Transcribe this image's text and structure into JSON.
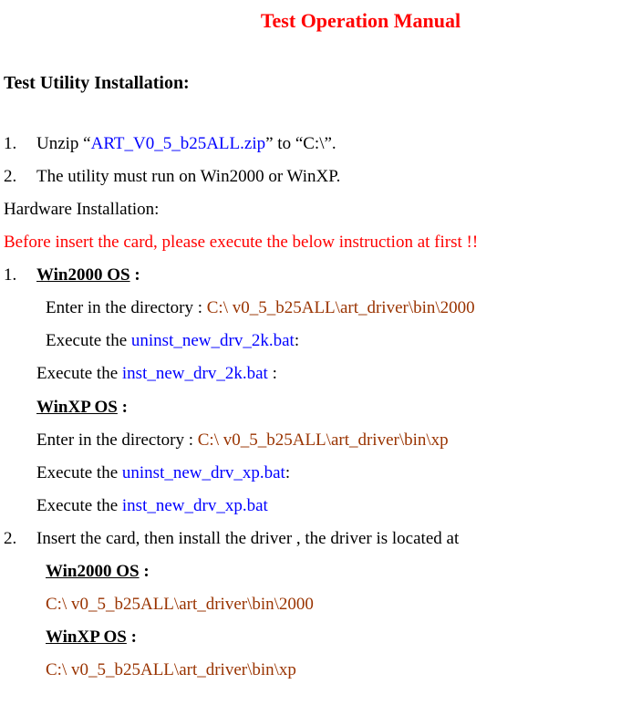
{
  "title": "Test Operation Manual",
  "section_heading": "Test Utility Installation:",
  "install_1_num": "1.",
  "install_1_prefix": "Unzip “",
  "install_1_file": "ART_V0_5_b25ALL.zip",
  "install_1_suffix": "” to “C:\\”.",
  "install_2_num": "2.",
  "install_2_text": "The utility must run on Win2000 or WinXP.",
  "hardware_heading": "Hardware Installation:",
  "before_text": "Before insert the card, please execute the below instruction at first !!",
  "hw_1_num": "1.",
  "win2000_label": "Win2000 OS",
  "win2000_colon": " :",
  "enter_dir_prefix": "Enter in the directory : ",
  "win2000_dir": "C:\\ v0_5_b25ALL\\art_driver\\bin\\2000",
  "execute_prefix": "Execute the ",
  "uninst_2k": "uninst_new_drv_2k.bat",
  "inst_2k": "inst_new_drv_2k.bat",
  "colon_after": ":",
  "space_colon": " :",
  "winxp_label": "WinXP OS",
  "winxp_colon": " :",
  "winxp_dir": "C:\\ v0_5_b25ALL\\art_driver\\bin\\xp",
  "uninst_xp": "uninst_new_drv_xp.bat",
  "inst_xp": "inst_new_drv_xp.bat",
  "hw_2_num": "2.",
  "hw_2_text": "Insert the card, then install the driver , the driver is located at",
  "win2000_path": "C:\\ v0_5_b25ALL\\art_driver\\bin\\2000",
  "winxp_path": "C:\\ v0_5_b25ALL\\art_driver\\bin\\xp"
}
